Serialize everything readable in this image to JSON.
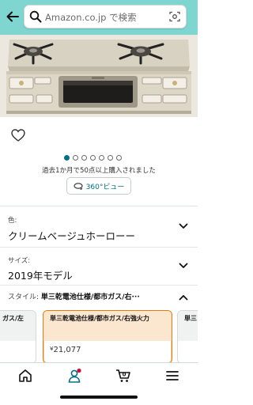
{
  "search": {
    "placeholder": "Amazon.co.jp で検索"
  },
  "gallery": {
    "image_count": 7,
    "active_index": 0,
    "purchase_info": "過去1か月で50点以上購入されました",
    "view360_label": "360°ビュー"
  },
  "color_option": {
    "label": "色:",
    "value": "クリームベージュホーローー"
  },
  "size_option": {
    "label": "サイズ:",
    "value": "2019年モデル"
  },
  "style_option": {
    "label": "スタイル: ",
    "value": "単三乾電池仕様/都市ガス/右···"
  },
  "style_cards": [
    {
      "title": "ガス/左",
      "price": ""
    },
    {
      "title": "単三乾電池仕様/都市ガス/右強火力",
      "price": "21,077",
      "currency": "¥"
    },
    {
      "title": "単三 力",
      "price": ""
    }
  ],
  "colors": {
    "header_bg": "#7fd6d0",
    "accent": "#007185",
    "selected_border": "#e47911",
    "badge": "#cc0c39"
  },
  "bottom_nav": [
    {
      "icon": "home-icon"
    },
    {
      "icon": "account-icon"
    },
    {
      "icon": "cart-icon",
      "count": "0"
    },
    {
      "icon": "menu-icon"
    }
  ]
}
